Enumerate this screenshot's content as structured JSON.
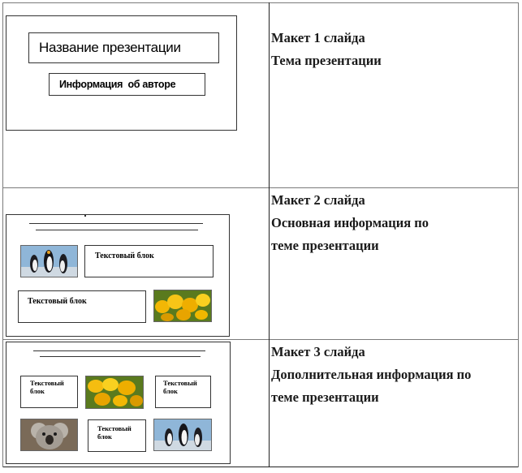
{
  "rows": [
    {
      "caption": "Макет 1 слайда",
      "lines": [
        "Тема презентации"
      ],
      "slide": {
        "title_box": "Название презентации",
        "author_box": "Информация  об авторе"
      }
    },
    {
      "caption": "Макет 2 слайда",
      "lines": [
        "Основная информация по",
        "теме презентации"
      ],
      "slide": {
        "text_box_1": "Текстовый блок",
        "text_box_2": "Текстовый блок"
      }
    },
    {
      "caption": "Макет 3 слайда",
      "lines": [
        "Дополнительная информация по",
        "теме презентации"
      ],
      "slide": {
        "text_box_1": "Текстовый блок",
        "text_box_2": "Текстовый блок",
        "text_box_3": "Текстовый блок"
      }
    }
  ],
  "images": {
    "penguins": "penguins-photo",
    "tulips": "yellow-tulips-photo",
    "koala": "koala-photo"
  }
}
